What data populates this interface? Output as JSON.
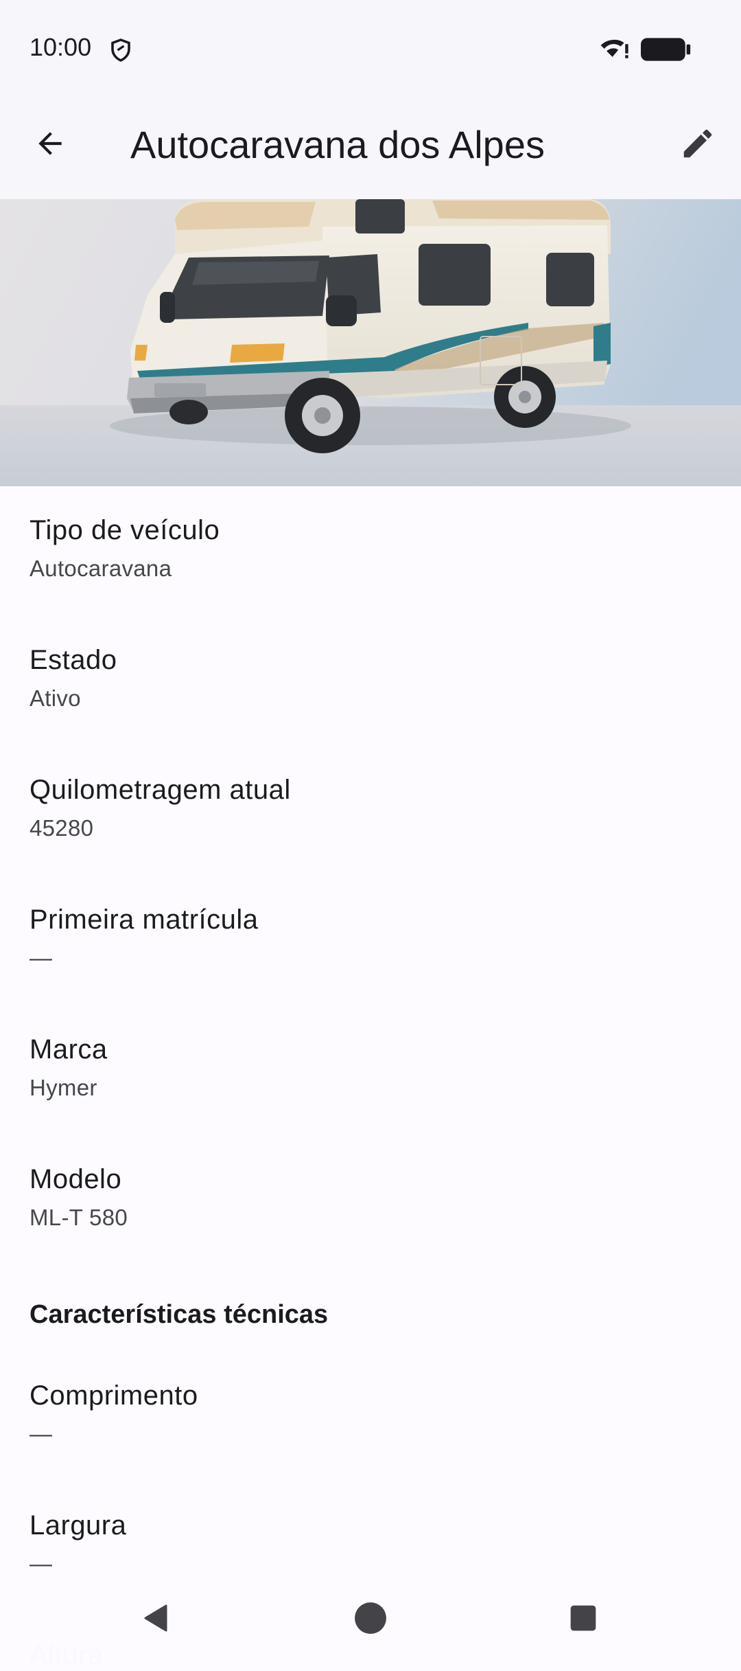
{
  "status_bar": {
    "time": "10:00",
    "icons": [
      "shield-icon",
      "wifi-icon",
      "battery-icon"
    ]
  },
  "app_bar": {
    "title": "Autocaravana dos Alpes",
    "back_icon": "arrow-back-icon",
    "edit_icon": "pencil-icon"
  },
  "hero": {
    "image": "motorhome-image"
  },
  "fields": [
    {
      "label": "Tipo de veículo",
      "value": "Autocaravana"
    },
    {
      "label": "Estado",
      "value": "Ativo"
    },
    {
      "label": "Quilometragem atual",
      "value": "45280"
    },
    {
      "label": "Primeira matrícula",
      "value": "—"
    },
    {
      "label": "Marca",
      "value": "Hymer"
    },
    {
      "label": "Modelo",
      "value": "ML-T 580"
    }
  ],
  "technical": {
    "title": "Características técnicas",
    "fields": [
      {
        "label": "Comprimento",
        "value": "—"
      },
      {
        "label": "Largura",
        "value": "—"
      },
      {
        "label": "Altura",
        "value": ""
      }
    ]
  },
  "nav_bar": {
    "icons": [
      "back-triangle-icon",
      "home-circle-icon",
      "recents-square-icon"
    ]
  },
  "colors": {
    "background": "#fdfbff",
    "app_bar": "#f7f6fb",
    "text_primary": "#1b1b1f",
    "text_secondary": "#46464f",
    "accent_stripe": "#2f7d8a"
  }
}
